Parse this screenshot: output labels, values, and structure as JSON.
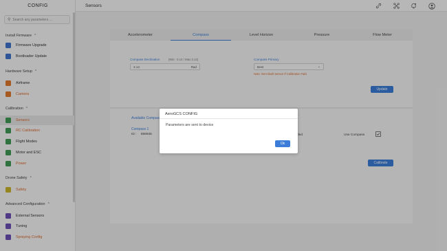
{
  "app": {
    "title": "CONFIG"
  },
  "search": {
    "placeholder": "Search any parameters ..."
  },
  "sidebar": {
    "sections": [
      {
        "label": "Install Firmware",
        "items": [
          {
            "label": "Firmware Upgrade"
          },
          {
            "label": "Bootloader Update"
          }
        ]
      },
      {
        "label": "Hardware Setup",
        "items": [
          {
            "label": "Airframe"
          },
          {
            "label": "Camera"
          }
        ]
      },
      {
        "label": "Calibration",
        "items": [
          {
            "label": "Sensors"
          },
          {
            "label": "RC Calibration"
          },
          {
            "label": "Flight Modes"
          },
          {
            "label": "Motor and ESC"
          },
          {
            "label": "Power"
          }
        ]
      },
      {
        "label": "Drone Safety",
        "items": [
          {
            "label": "Safety"
          }
        ]
      },
      {
        "label": "Advanced Configuration",
        "items": [
          {
            "label": "External Sensors"
          },
          {
            "label": "Tuning"
          },
          {
            "label": "Spraying Config"
          }
        ]
      }
    ]
  },
  "header": {
    "title": "Sensors"
  },
  "tabs": [
    {
      "label": "Accelerometer"
    },
    {
      "label": "Compass"
    },
    {
      "label": "Level Horizon"
    },
    {
      "label": "Pressure"
    },
    {
      "label": "Flow Meter"
    }
  ],
  "compass": {
    "declination_label": "Compass Declination",
    "declination_range": "(Min: -3.14 / Max 3.14)",
    "declination_value": "3.14",
    "declination_unit": "Rad",
    "primary_label": "Compass Primary",
    "primary_value": "Best",
    "note": "Note: Set Inbuilt Sensor If Calibration Fails",
    "update_label": "Update",
    "available_label": "Available Compass",
    "compass_name": "Compass 1",
    "compass_id_label": "ID :",
    "compass_id": "658945",
    "status_fragment": "ded",
    "use_compass_label": "Use Compass",
    "calibrate_label": "Calibrate"
  },
  "dialog": {
    "title": "AeroGCS CONFIG",
    "message": "Parameters are sent to device",
    "ok_label": "Ok"
  },
  "colors": {
    "accent": "#3b7dd8",
    "warning": "#d9692b"
  }
}
